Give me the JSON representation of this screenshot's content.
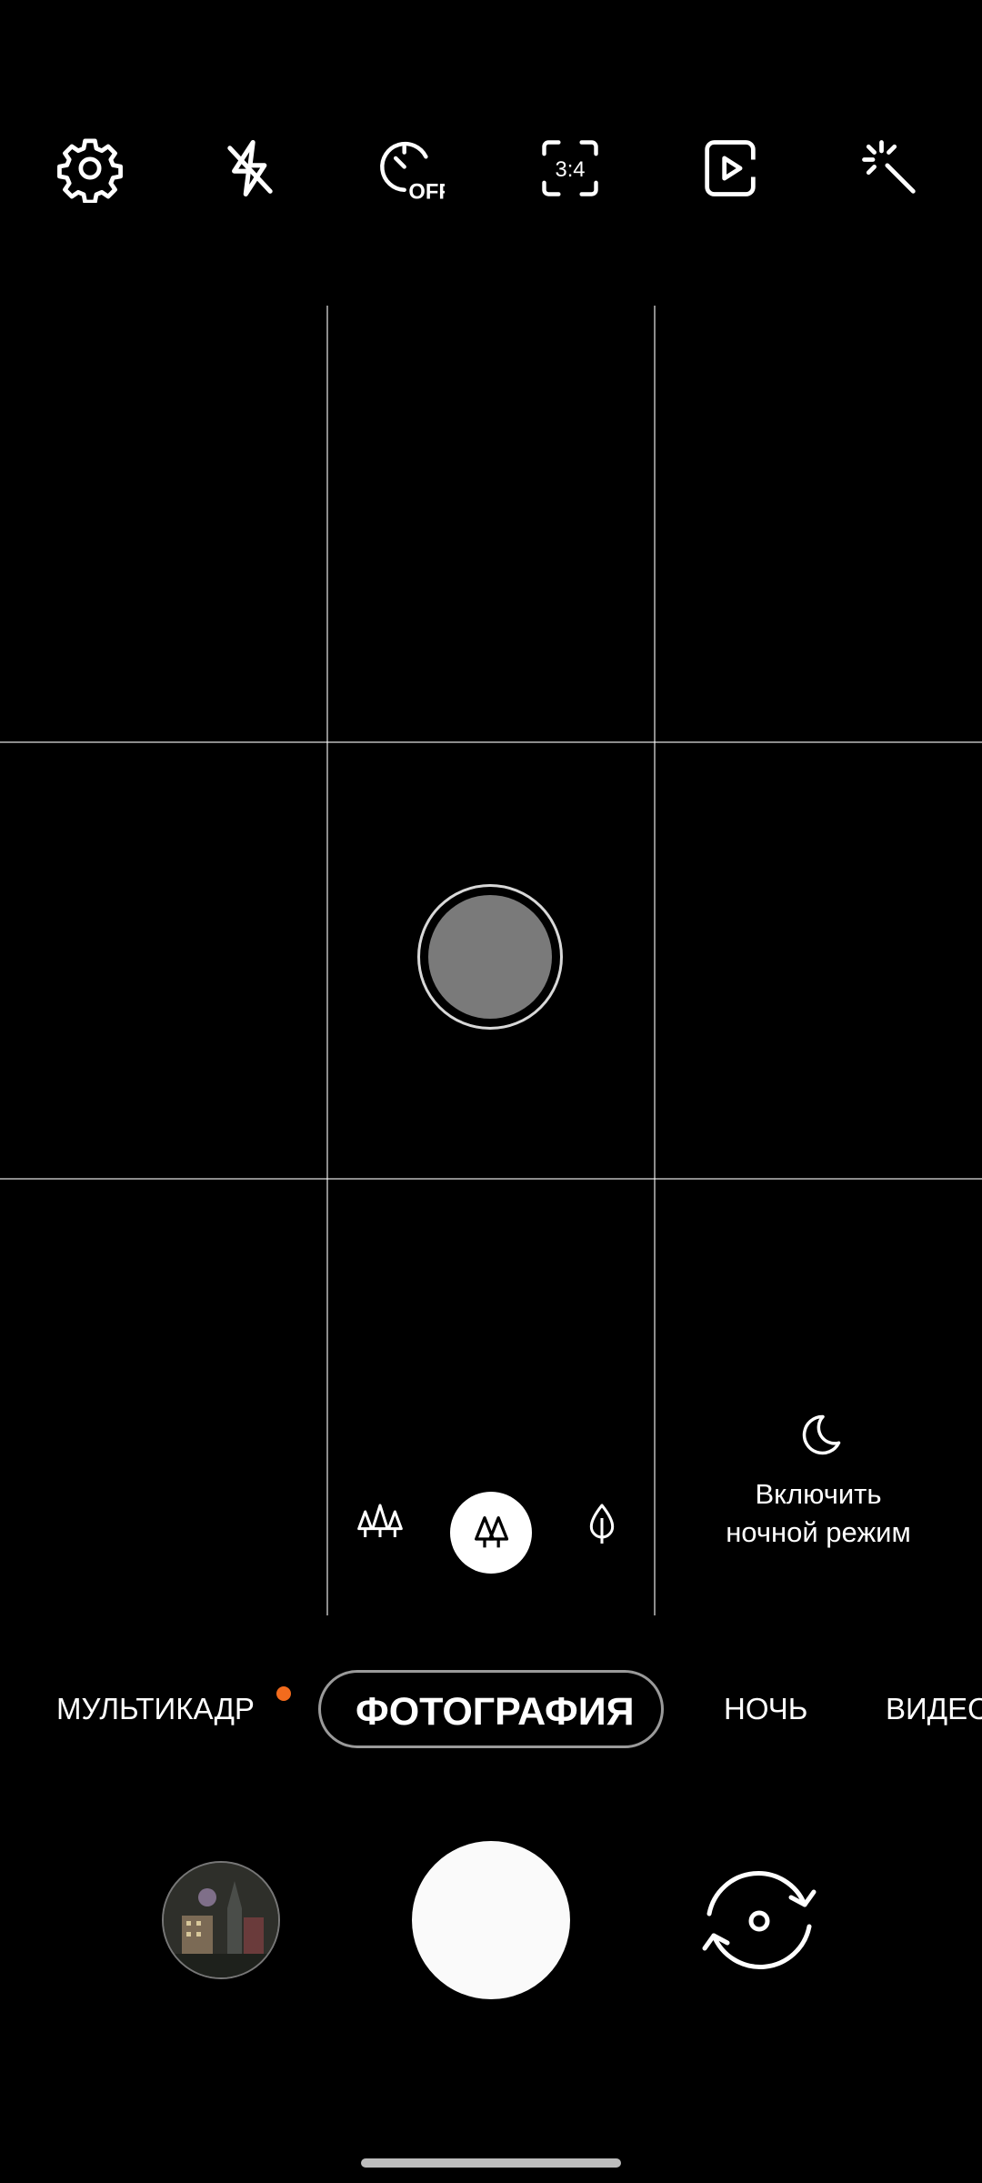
{
  "top_bar": {
    "icons": [
      "gear-icon",
      "flash-off-icon",
      "timer-off-icon",
      "aspect-ratio-icon",
      "motion-photo-icon",
      "effects-wand-icon"
    ],
    "timer_label": "OFF",
    "ratio_label": "3:4"
  },
  "viewfinder": {
    "zoom_options": [
      "wide-lens-icon",
      "standard-lens-icon",
      "tele-lens-icon"
    ],
    "zoom_selected": "standard-lens-icon",
    "night_hint": {
      "icon": "moon-icon",
      "line1": "Включить",
      "line2": "ночной режим"
    }
  },
  "modes": {
    "items": [
      "МУЛЬТИКАДР",
      "ФОТОГРАФИЯ",
      "НОЧЬ",
      "ВИДЕО"
    ],
    "selected": "ФОТОГРАФИЯ",
    "badge_color": "#f26b1d"
  },
  "bottom": {
    "gallery_icon": "gallery-thumbnail",
    "shutter_icon": "shutter-button",
    "switch_icon": "switch-camera-icon"
  }
}
